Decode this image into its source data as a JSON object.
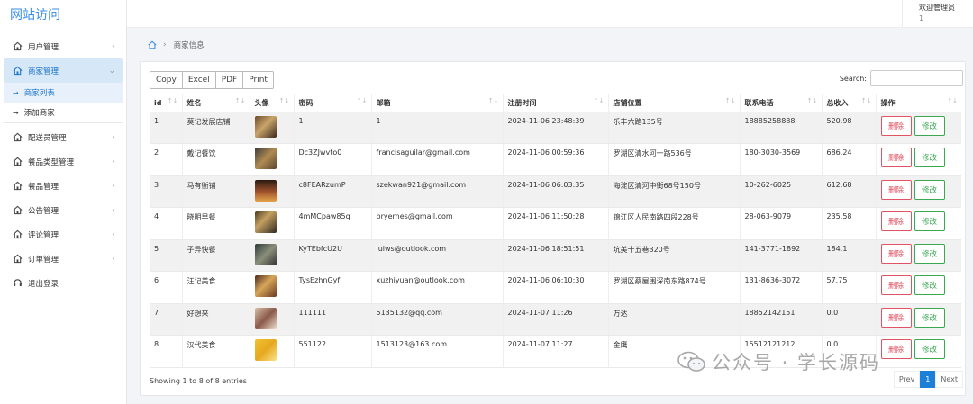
{
  "brand": "网站访问",
  "header": {
    "welcome": "欢迎管理员",
    "user_id": "1"
  },
  "breadcrumb": {
    "current": "商家信息"
  },
  "sidebar": {
    "items": [
      {
        "label": "用户管理",
        "icon": "home-icon"
      },
      {
        "label": "商家管理",
        "icon": "home-icon"
      },
      {
        "label": "配送员管理",
        "icon": "home-icon"
      },
      {
        "label": "餐品类型管理",
        "icon": "home-icon"
      },
      {
        "label": "餐品管理",
        "icon": "home-icon"
      },
      {
        "label": "公告管理",
        "icon": "home-icon"
      },
      {
        "label": "评论管理",
        "icon": "home-icon"
      },
      {
        "label": "订单管理",
        "icon": "home-icon"
      },
      {
        "label": "退出登录",
        "icon": "headset-icon"
      }
    ],
    "sub_items": [
      "商家列表",
      "添加商家"
    ]
  },
  "toolbar": {
    "copy": "Copy",
    "excel": "Excel",
    "pdf": "PDF",
    "print": "Print"
  },
  "search": {
    "label": "Search:",
    "value": ""
  },
  "table": {
    "columns": [
      "id",
      "姓名",
      "头像",
      "密码",
      "邮箱",
      "注册时间",
      "店铺位置",
      "联系电话",
      "总收入",
      "操作"
    ],
    "rows": [
      {
        "id": "1",
        "name": "莫记发展店铺",
        "password": "1",
        "email": "1",
        "time": "2024-11-06 23:48:39",
        "location": "乐丰六路135号",
        "phone": "18885258888",
        "income": "520.98"
      },
      {
        "id": "2",
        "name": "戴记餐饮",
        "password": "Dc3ZJwvto0",
        "email": "francisaguilar@gmail.com",
        "time": "2024-11-06 00:59:36",
        "location": "罗湖区清水河一路536号",
        "phone": "180-3030-3569",
        "income": "686.24"
      },
      {
        "id": "3",
        "name": "马有衡铺",
        "password": "c8FEARzumP",
        "email": "szekwan921@gmail.com",
        "time": "2024-11-06 06:03:35",
        "location": "海淀区清河中街68号150号",
        "phone": "10-262-6025",
        "income": "612.68"
      },
      {
        "id": "4",
        "name": "晓明早餐",
        "password": "4mMCpaw85q",
        "email": "bryernes@gmail.com",
        "time": "2024-11-06 11:50:28",
        "location": "锦江区人民南路四段228号",
        "phone": "28-063-9079",
        "income": "235.58"
      },
      {
        "id": "5",
        "name": "子异快餐",
        "password": "KyTEbfcU2U",
        "email": "luiws@outlook.com",
        "time": "2024-11-06 18:51:51",
        "location": "坑美十五巷320号",
        "phone": "141-3771-1892",
        "income": "184.1"
      },
      {
        "id": "6",
        "name": "汪记美食",
        "password": "TysEzhnGyf",
        "email": "xuzhiyuan@outlook.com",
        "time": "2024-11-06 06:10:30",
        "location": "罗湖区蔡屋围深南东路874号",
        "phone": "131-8636-3072",
        "income": "57.75"
      },
      {
        "id": "7",
        "name": "好想来",
        "password": "111111",
        "email": "5135132@qq.com",
        "time": "2024-11-07 11:26",
        "location": "万达",
        "phone": "18852142151",
        "income": "0.0"
      },
      {
        "id": "8",
        "name": "汉代美食",
        "password": "551122",
        "email": "1513123@163.com",
        "time": "2024-11-07 11:27",
        "location": "金鹰",
        "phone": "15512121212",
        "income": "0.0"
      }
    ],
    "delete_label": "删除",
    "edit_label": "修改"
  },
  "footer": {
    "info": "Showing 1 to 8 of 8 entries"
  },
  "pager": {
    "prev": "Prev",
    "current": "1",
    "next": "Next"
  },
  "watermark": "公众号 · 学长源码",
  "colors": {
    "brand": "#3a8ee6",
    "active_bg": "#d6e7f7",
    "delete": "#e15262",
    "edit": "#3aa851",
    "page_active": "#1c7fd8"
  }
}
